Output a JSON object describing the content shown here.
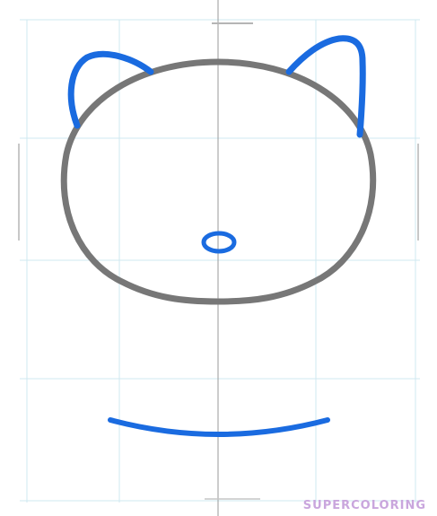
{
  "canvas": {
    "background": "#ffffff"
  },
  "colors": {
    "grid": "#cfe8f0",
    "center_axis": "#9a9a9a",
    "head_outline": "#777777",
    "new_step_stroke": "#1a6be0"
  },
  "drawing": {
    "subject": "cat",
    "parts": [
      "left-ear",
      "right-ear",
      "head",
      "nose",
      "body-base-curve"
    ]
  },
  "watermark": {
    "text": "SUPERCOLORING",
    "color": "#c9a6dd"
  }
}
